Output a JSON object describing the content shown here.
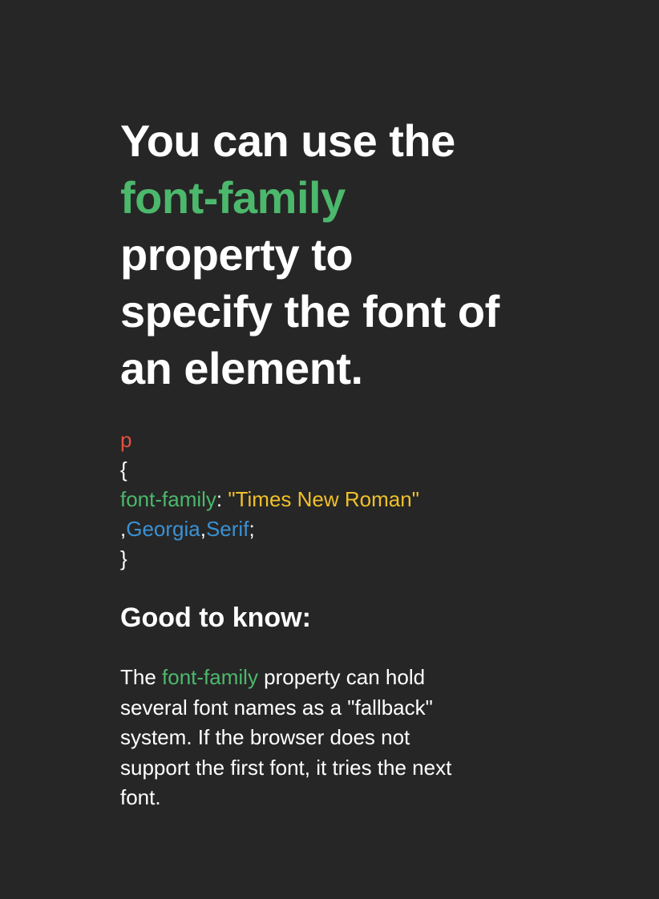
{
  "headline": {
    "line1": "You can use the",
    "line2_highlight": "font-family",
    "line3": "property to",
    "line4": "specify the font of",
    "line5": "an element."
  },
  "code": {
    "selector": "p",
    "open_brace": "{",
    "property": "font-family",
    "colon": ":",
    "value_string": " \"Times New Roman\"",
    "comma1": ",",
    "value_font1": "Georgia",
    "comma2": ",",
    "value_font2": "Serif",
    "semicolon": ";",
    "close_brace": "}"
  },
  "good_to_know": {
    "heading": "Good to know:",
    "para_prefix": "The ",
    "para_highlight": "font-family",
    "para_line1_suffix": " property can hold",
    "para_line2": "several font names as a \"fallback\"",
    "para_line3": "system. If the browser does not",
    "para_line4": "support the first font, it tries the next",
    "para_line5": "font."
  },
  "colors": {
    "background": "#262626",
    "text": "#ffffff",
    "accent_green": "#4cb86c",
    "selector_red": "#e3503e",
    "string_yellow": "#f0c02a",
    "value_blue": "#3a91d4"
  }
}
